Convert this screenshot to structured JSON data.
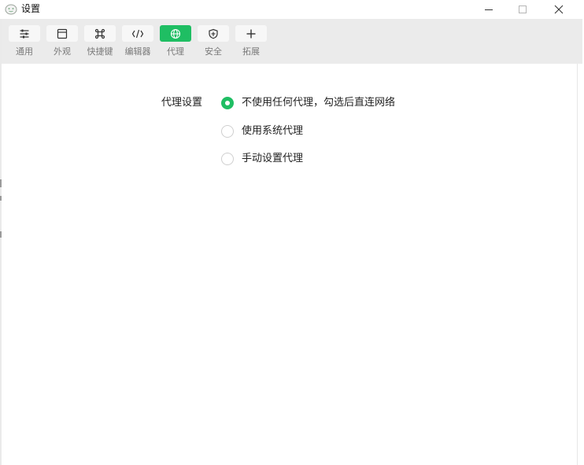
{
  "window": {
    "title": "设置"
  },
  "toolbar": {
    "items": [
      {
        "label": "通用",
        "icon": "sliders-icon",
        "active": false
      },
      {
        "label": "外观",
        "icon": "window-icon",
        "active": false
      },
      {
        "label": "快捷键",
        "icon": "command-key-icon",
        "active": false
      },
      {
        "label": "编辑器",
        "icon": "code-icon",
        "active": false
      },
      {
        "label": "代理",
        "icon": "globe-icon",
        "active": true
      },
      {
        "label": "安全",
        "icon": "shield-icon",
        "active": false
      },
      {
        "label": "拓展",
        "icon": "plus-icon",
        "active": false
      }
    ]
  },
  "proxy": {
    "label": "代理设置",
    "options": [
      {
        "label": "不使用任何代理，勾选后直连网络",
        "selected": true
      },
      {
        "label": "使用系统代理",
        "selected": false
      },
      {
        "label": "手动设置代理",
        "selected": false
      }
    ]
  },
  "colors": {
    "accent": "#1fbe63",
    "toolbar_bg": "#ebebeb",
    "label_gray": "#7a7a7a"
  }
}
